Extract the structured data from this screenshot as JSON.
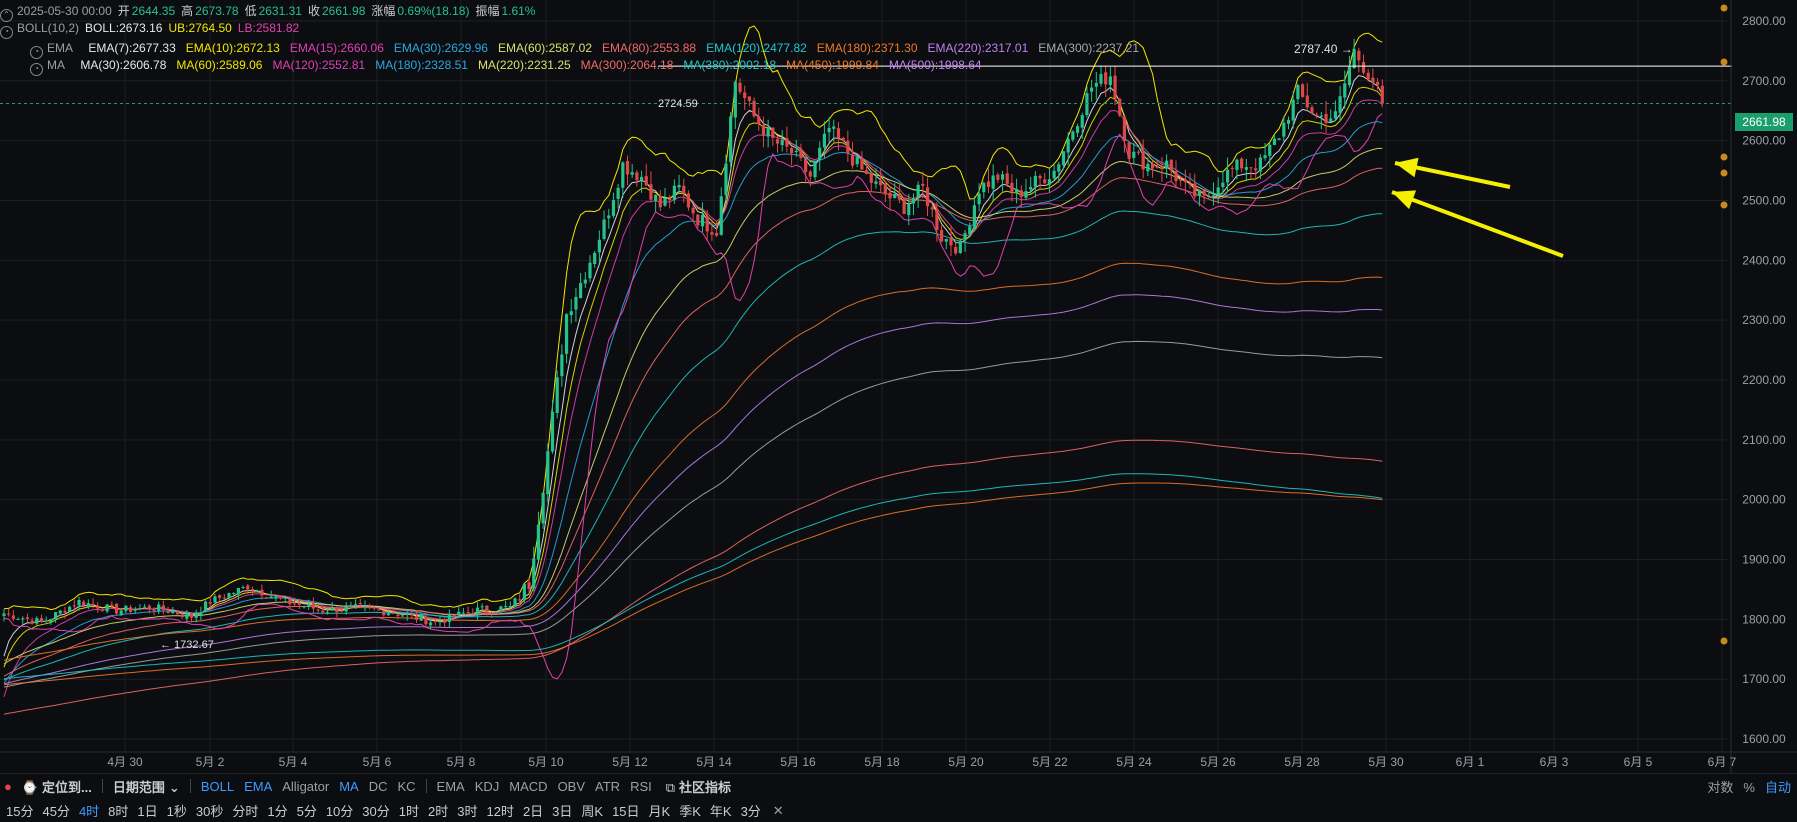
{
  "header": {
    "date": "2025-05-30 00:00",
    "open_label": "开",
    "open": "2644.35",
    "high_label": "高",
    "high": "2673.78",
    "low_label": "低",
    "low": "2631.31",
    "close_label": "收",
    "close": "2661.98",
    "change_label": "涨幅",
    "change": "0.69%(18.18)",
    "amp_label": "振幅",
    "amp": "1.61%"
  },
  "boll": {
    "name": "BOLL(10,2)",
    "mid": "BOLL:2673.16",
    "ub": "UB:2764.50",
    "lb": "LB:2581.82"
  },
  "ema": {
    "name": "EMA",
    "items": [
      {
        "text": "EMA(7):2677.33",
        "color": "#e8e8e8"
      },
      {
        "text": "EMA(10):2672.13",
        "color": "#f2e600"
      },
      {
        "text": "EMA(15):2660.06",
        "color": "#e040b0"
      },
      {
        "text": "EMA(30):2629.96",
        "color": "#2aa8e0"
      },
      {
        "text": "EMA(60):2587.02",
        "color": "#d8e070"
      },
      {
        "text": "EMA(80):2553.88",
        "color": "#f06a6a"
      },
      {
        "text": "EMA(120):2477.82",
        "color": "#20c8c8"
      },
      {
        "text": "EMA(180):2371.30",
        "color": "#f07828"
      },
      {
        "text": "EMA(220):2317.01",
        "color": "#c080f0"
      },
      {
        "text": "EMA(300):2237.21",
        "color": "#a8a8a8"
      }
    ]
  },
  "ma": {
    "name": "MA",
    "items": [
      {
        "text": "MA(30):2606.78",
        "color": "#e8e8e8"
      },
      {
        "text": "MA(60):2589.06",
        "color": "#f2e600"
      },
      {
        "text": "MA(120):2552.81",
        "color": "#e040b0"
      },
      {
        "text": "MA(180):2328.51",
        "color": "#2aa8e0"
      },
      {
        "text": "MA(220):2231.25",
        "color": "#d8e070"
      },
      {
        "text": "MA(300):2064.18",
        "color": "#f06a6a"
      },
      {
        "text": "MA(380):2002.18",
        "color": "#20c8c8"
      },
      {
        "text": "MA(450):1999.84",
        "color": "#f07828"
      },
      {
        "text": "MA(500):1998.64",
        "color": "#c080f0"
      }
    ]
  },
  "price_tag": "2661.98",
  "annotations": {
    "high_label": "2787.40",
    "low_label": "1732.67",
    "level_label": "2724.59"
  },
  "toolbar1": {
    "locate": "定位到...",
    "date_range": "日期范围",
    "indicators": [
      "BOLL",
      "EMA",
      "Alligator",
      "MA",
      "DC",
      "KC"
    ],
    "sub_indicators": [
      "EMA",
      "KDJ",
      "MACD",
      "OBV",
      "ATR",
      "RSI"
    ],
    "community": "社区指标",
    "right": [
      "对数",
      "%",
      "自动"
    ]
  },
  "toolbar2": {
    "intervals": [
      "15分",
      "45分",
      "4时",
      "8时",
      "1日",
      "1秒",
      "30秒",
      "分时",
      "1分",
      "5分",
      "10分",
      "30分",
      "1时",
      "2时",
      "3时",
      "12时",
      "2日",
      "3日",
      "周K",
      "15日",
      "月K",
      "季K",
      "年K",
      "3分"
    ],
    "active": "4时"
  },
  "chart_data": {
    "type": "candlestick",
    "x_labels": [
      "4月 30",
      "5月 2",
      "5月 4",
      "5月 6",
      "5月 8",
      "5月 10",
      "5月 12",
      "5月 14",
      "5月 16",
      "5月 18",
      "5月 20",
      "5月 22",
      "5月 24",
      "5月 26",
      "5月 28",
      "5月 30",
      "6月 1",
      "6月 3",
      "6月 5",
      "6月 7"
    ],
    "y_ticks": [
      1600,
      1700,
      1800,
      1900,
      2000,
      2100,
      2200,
      2300,
      2400,
      2500,
      2600,
      2700,
      2800
    ],
    "ylim": [
      1565,
      2835
    ],
    "last_close": 2661.98,
    "horizontal_level": 2724.59,
    "anchors": [
      [
        0,
        1810
      ],
      [
        8,
        1795
      ],
      [
        16,
        1830
      ],
      [
        24,
        1815
      ],
      [
        32,
        1820
      ],
      [
        40,
        1805
      ],
      [
        44,
        1830
      ],
      [
        52,
        1855
      ],
      [
        60,
        1830
      ],
      [
        68,
        1815
      ],
      [
        76,
        1820
      ],
      [
        84,
        1810
      ],
      [
        92,
        1795
      ],
      [
        100,
        1815
      ],
      [
        108,
        1820
      ],
      [
        112,
        1860
      ],
      [
        116,
        2080
      ],
      [
        120,
        2310
      ],
      [
        124,
        2380
      ],
      [
        128,
        2460
      ],
      [
        132,
        2560
      ],
      [
        136,
        2540
      ],
      [
        140,
        2490
      ],
      [
        144,
        2520
      ],
      [
        148,
        2470
      ],
      [
        152,
        2450
      ],
      [
        156,
        2700
      ],
      [
        160,
        2640
      ],
      [
        164,
        2600
      ],
      [
        168,
        2580
      ],
      [
        172,
        2540
      ],
      [
        176,
        2620
      ],
      [
        180,
        2580
      ],
      [
        184,
        2540
      ],
      [
        188,
        2510
      ],
      [
        192,
        2490
      ],
      [
        196,
        2520
      ],
      [
        200,
        2440
      ],
      [
        204,
        2420
      ],
      [
        208,
        2520
      ],
      [
        212,
        2540
      ],
      [
        216,
        2510
      ],
      [
        220,
        2530
      ],
      [
        224,
        2550
      ],
      [
        228,
        2620
      ],
      [
        232,
        2690
      ],
      [
        236,
        2710
      ],
      [
        240,
        2580
      ],
      [
        244,
        2560
      ],
      [
        248,
        2560
      ],
      [
        252,
        2520
      ],
      [
        256,
        2500
      ],
      [
        260,
        2540
      ],
      [
        264,
        2560
      ],
      [
        268,
        2560
      ],
      [
        272,
        2610
      ],
      [
        276,
        2680
      ],
      [
        280,
        2640
      ],
      [
        284,
        2640
      ],
      [
        288,
        2750
      ],
      [
        292,
        2700
      ],
      [
        294,
        2661.98
      ]
    ],
    "ma_series": [
      {
        "color": "#e8e8e8",
        "end": 2677.33,
        "w": 0.35
      },
      {
        "color": "#f2e600",
        "end": 2672.13,
        "w": 0.25
      },
      {
        "color": "#e040b0",
        "end": 2660.06,
        "w": 0.18
      },
      {
        "color": "#2aa8e0",
        "end": 2629.96,
        "w": 0.1
      },
      {
        "color": "#d8e070",
        "end": 2587.02,
        "w": 0.06
      },
      {
        "color": "#f06a6a",
        "end": 2553.88,
        "w": 0.045
      },
      {
        "color": "#20c8c8",
        "end": 2477.82,
        "w": 0.032
      },
      {
        "color": "#f07828",
        "end": 2371.3,
        "w": 0.022
      },
      {
        "color": "#c080f0",
        "end": 2317.01,
        "w": 0.018
      },
      {
        "color": "#a8a8a8",
        "end": 2237.21,
        "w": 0.014
      },
      {
        "color": "#f06a6a",
        "end": 2064.18,
        "w": 0.009
      },
      {
        "color": "#20c8c8",
        "end": 2002.18,
        "w": 0.0075
      },
      {
        "color": "#f07828",
        "end": 1999.84,
        "w": 0.0068
      }
    ]
  }
}
